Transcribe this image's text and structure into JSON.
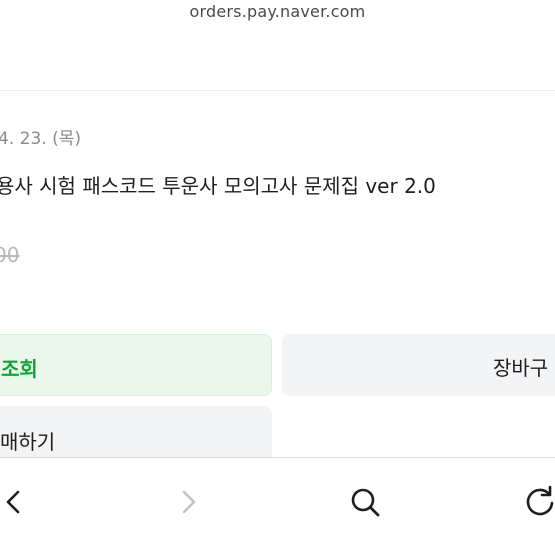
{
  "browser": {
    "url": "orders.pay.naver.com"
  },
  "order": {
    "date": "4. 23. (목)",
    "product_name": "용사 시험 패스코드 투운사 모의고사 문제집 ver 2.0",
    "price": "00"
  },
  "actions": {
    "track_label": "조회",
    "cart_label": "장바구",
    "rebuy_label": "매하기"
  },
  "toolbar": {
    "back_icon": "chevron-left-icon",
    "forward_icon": "chevron-right-icon",
    "search_icon": "search-icon",
    "reload_icon": "reload-icon"
  },
  "colors": {
    "accent_green": "#12a437",
    "accent_green_bg": "#e9f8ea",
    "button_gray_bg": "#f3f4f6",
    "muted_text": "#8a8a8a"
  }
}
